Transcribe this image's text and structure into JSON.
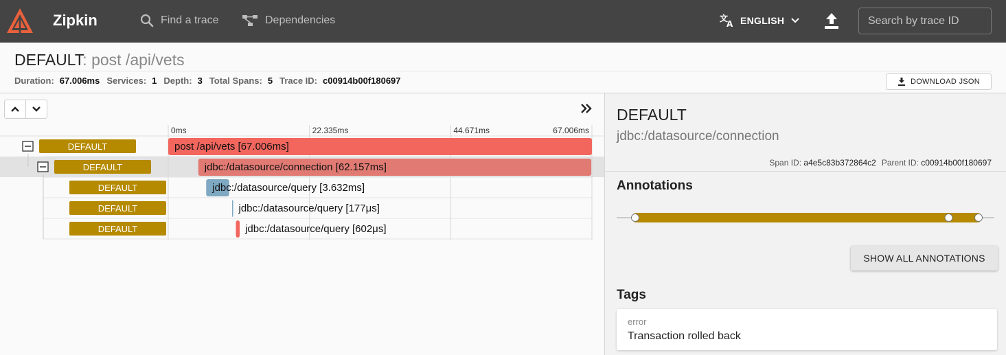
{
  "nav": {
    "brand": "Zipkin",
    "find_trace": "Find a trace",
    "dependencies": "Dependencies",
    "language": "ENGLISH",
    "search_placeholder": "Search by trace ID"
  },
  "trace": {
    "service": "DEFAULT",
    "separator": ": ",
    "span_name": "post /api/vets",
    "meta": [
      {
        "key": "Duration:",
        "value": "67.006ms"
      },
      {
        "key": "Services:",
        "value": "1"
      },
      {
        "key": "Depth:",
        "value": "3"
      },
      {
        "key": "Total Spans:",
        "value": "5"
      },
      {
        "key": "Trace ID:",
        "value": "c00914b00f180697"
      }
    ],
    "download_label": "DOWNLOAD JSON"
  },
  "timeline": {
    "ticks": [
      "0ms",
      "22.335ms",
      "44.671ms",
      "67.006ms"
    ],
    "total_ms": 67.006,
    "spans": [
      {
        "service": "DEFAULT",
        "name": "post /api/vets [67.006ms]",
        "start_ms": 0,
        "duration_ms": 67.006,
        "depth": 0,
        "collapsible": true,
        "color": "#f2665e",
        "selected": false
      },
      {
        "service": "DEFAULT",
        "name": "jdbc:/datasource/connection [62.157ms]",
        "start_ms": 4.75,
        "duration_ms": 62.157,
        "depth": 1,
        "collapsible": true,
        "color": "#e07a73",
        "selected": true
      },
      {
        "service": "DEFAULT",
        "name": "jdbc:/datasource/query [3.632ms]",
        "start_ms": 6.0,
        "duration_ms": 3.632,
        "depth": 2,
        "collapsible": false,
        "color": "#7fa8c2",
        "selected": false
      },
      {
        "service": "DEFAULT",
        "name": "jdbc:/datasource/query [177μs]",
        "start_ms": 10.1,
        "duration_ms": 0.177,
        "depth": 2,
        "collapsible": false,
        "color": "#7fa8c2",
        "selected": false
      },
      {
        "service": "DEFAULT",
        "name": "jdbc:/datasource/query [602μs]",
        "start_ms": 10.7,
        "duration_ms": 0.602,
        "depth": 2,
        "collapsible": false,
        "color": "#f2665e",
        "selected": false
      }
    ]
  },
  "detail": {
    "service": "DEFAULT",
    "span_name": "jdbc:/datasource/connection",
    "span_id_label": "Span ID:",
    "span_id": "a4e5c83b372864c2",
    "parent_id_label": "Parent ID:",
    "parent_id": "c00914b00f180697",
    "annotations_title": "Annotations",
    "annotation_points": [
      0.0,
      0.913,
      1.0
    ],
    "show_all_label": "SHOW ALL ANNOTATIONS",
    "tags_title": "Tags",
    "tags": [
      {
        "key": "error",
        "value": "Transaction rolled back"
      }
    ]
  },
  "colors": {
    "topbar": "#444444",
    "service_badge": "#b58a00",
    "annotation_bar": "#b58a00",
    "logo": "#e8603c"
  }
}
